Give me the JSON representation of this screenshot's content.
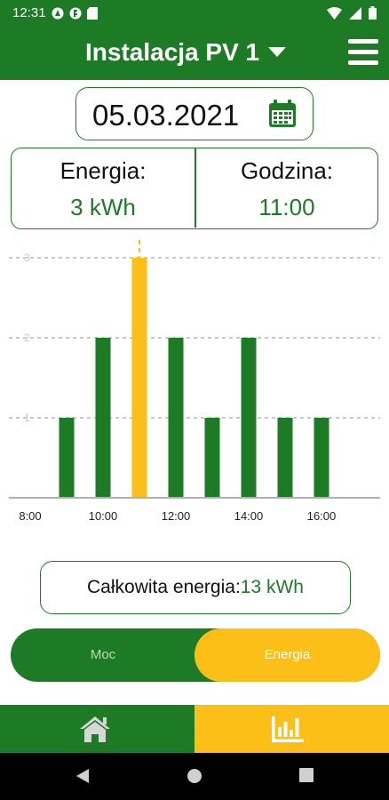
{
  "status_bar": {
    "time": "12:31",
    "left_icons": [
      "badge-icon",
      "badge-icon",
      "sd-card-icon"
    ],
    "right_icons": [
      "wifi-icon",
      "signal-icon",
      "battery-icon"
    ]
  },
  "header": {
    "title": "Instalacja PV 1",
    "dropdown_icon": "caret-down-icon",
    "menu_icon": "hamburger-menu-icon"
  },
  "date_picker": {
    "value": "05.03.2021",
    "icon": "calendar-icon"
  },
  "summary": {
    "energy_label": "Energia:",
    "energy_value": "3 kWh",
    "hour_label": "Godzina:",
    "hour_value": "11:00"
  },
  "chart_data": {
    "type": "bar",
    "x_ticks": [
      "8:00",
      "10:00",
      "12:00",
      "14:00",
      "16:00"
    ],
    "y_ticks": [
      "1",
      "2",
      "3"
    ],
    "ylim": [
      0,
      3
    ],
    "categories": [
      "9:00",
      "10:00",
      "11:00",
      "12:00",
      "13:00",
      "14:00",
      "15:00",
      "16:00"
    ],
    "values": [
      1,
      2,
      3,
      2,
      1,
      2,
      1,
      1
    ],
    "selected_category": "11:00",
    "grid": true,
    "colors": {
      "bar": "#1e7b25",
      "selected": "#fbbf18",
      "grid": "#b5b5b5",
      "axis": "#b0b0b0"
    }
  },
  "total": {
    "label": "Całkowita energia:",
    "value": "13 kWh"
  },
  "mode_toggle": {
    "options": [
      "Moc",
      "Energia"
    ],
    "selected": "Energia"
  },
  "bottom_nav": {
    "tabs": [
      {
        "icon": "home-icon",
        "selected": false
      },
      {
        "icon": "bar-chart-icon",
        "selected": true
      }
    ]
  },
  "system_nav": [
    "back-icon",
    "home-circle-icon",
    "recents-icon"
  ],
  "colors": {
    "primary": "#1e7b25",
    "accent": "#fbbf18"
  }
}
